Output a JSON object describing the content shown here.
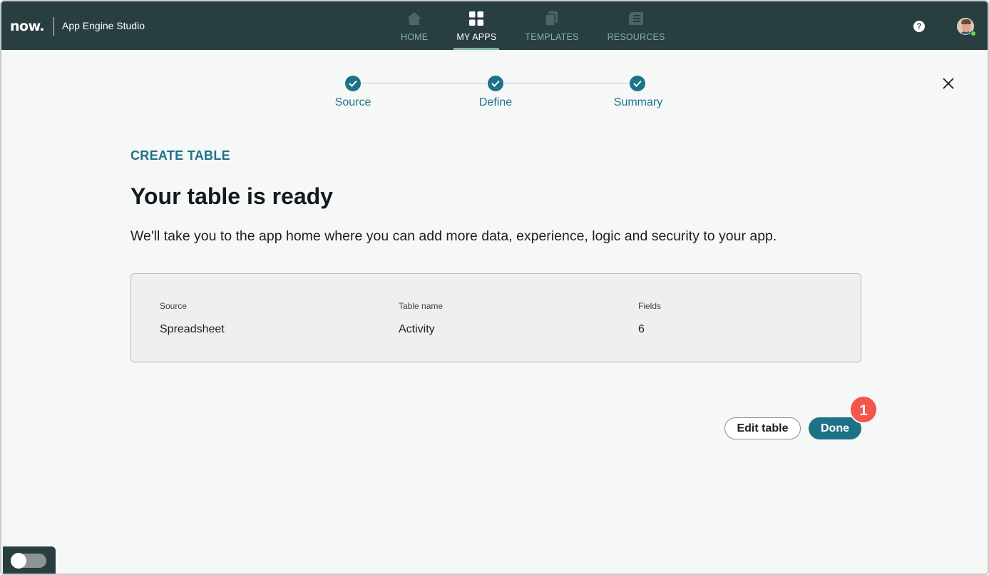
{
  "header": {
    "logo": "now.",
    "app_title": "App Engine Studio",
    "nav": [
      {
        "label": "HOME",
        "icon": "home-icon",
        "active": false
      },
      {
        "label": "MY APPS",
        "icon": "grid-icon",
        "active": true
      },
      {
        "label": "TEMPLATES",
        "icon": "templates-icon",
        "active": false
      },
      {
        "label": "RESOURCES",
        "icon": "resources-icon",
        "active": false
      }
    ],
    "help_label": "?"
  },
  "stepper": {
    "steps": [
      {
        "label": "Source",
        "status": "complete"
      },
      {
        "label": "Define",
        "status": "complete"
      },
      {
        "label": "Summary",
        "status": "complete"
      }
    ]
  },
  "content": {
    "eyebrow": "CREATE TABLE",
    "title": "Your table is ready",
    "description": "We'll take you to the app home where you can add more data, experience, logic and security to your app."
  },
  "summary": {
    "source_label": "Source",
    "source_value": "Spreadsheet",
    "table_name_label": "Table name",
    "table_name_value": "Activity",
    "fields_label": "Fields",
    "fields_value": "6"
  },
  "actions": {
    "edit_label": "Edit table",
    "done_label": "Done",
    "callout_number": "1"
  },
  "colors": {
    "header_bg": "#293e40",
    "accent": "#1e7288",
    "nav_active_underline": "#81b5a1",
    "callout": "#f2574c"
  }
}
